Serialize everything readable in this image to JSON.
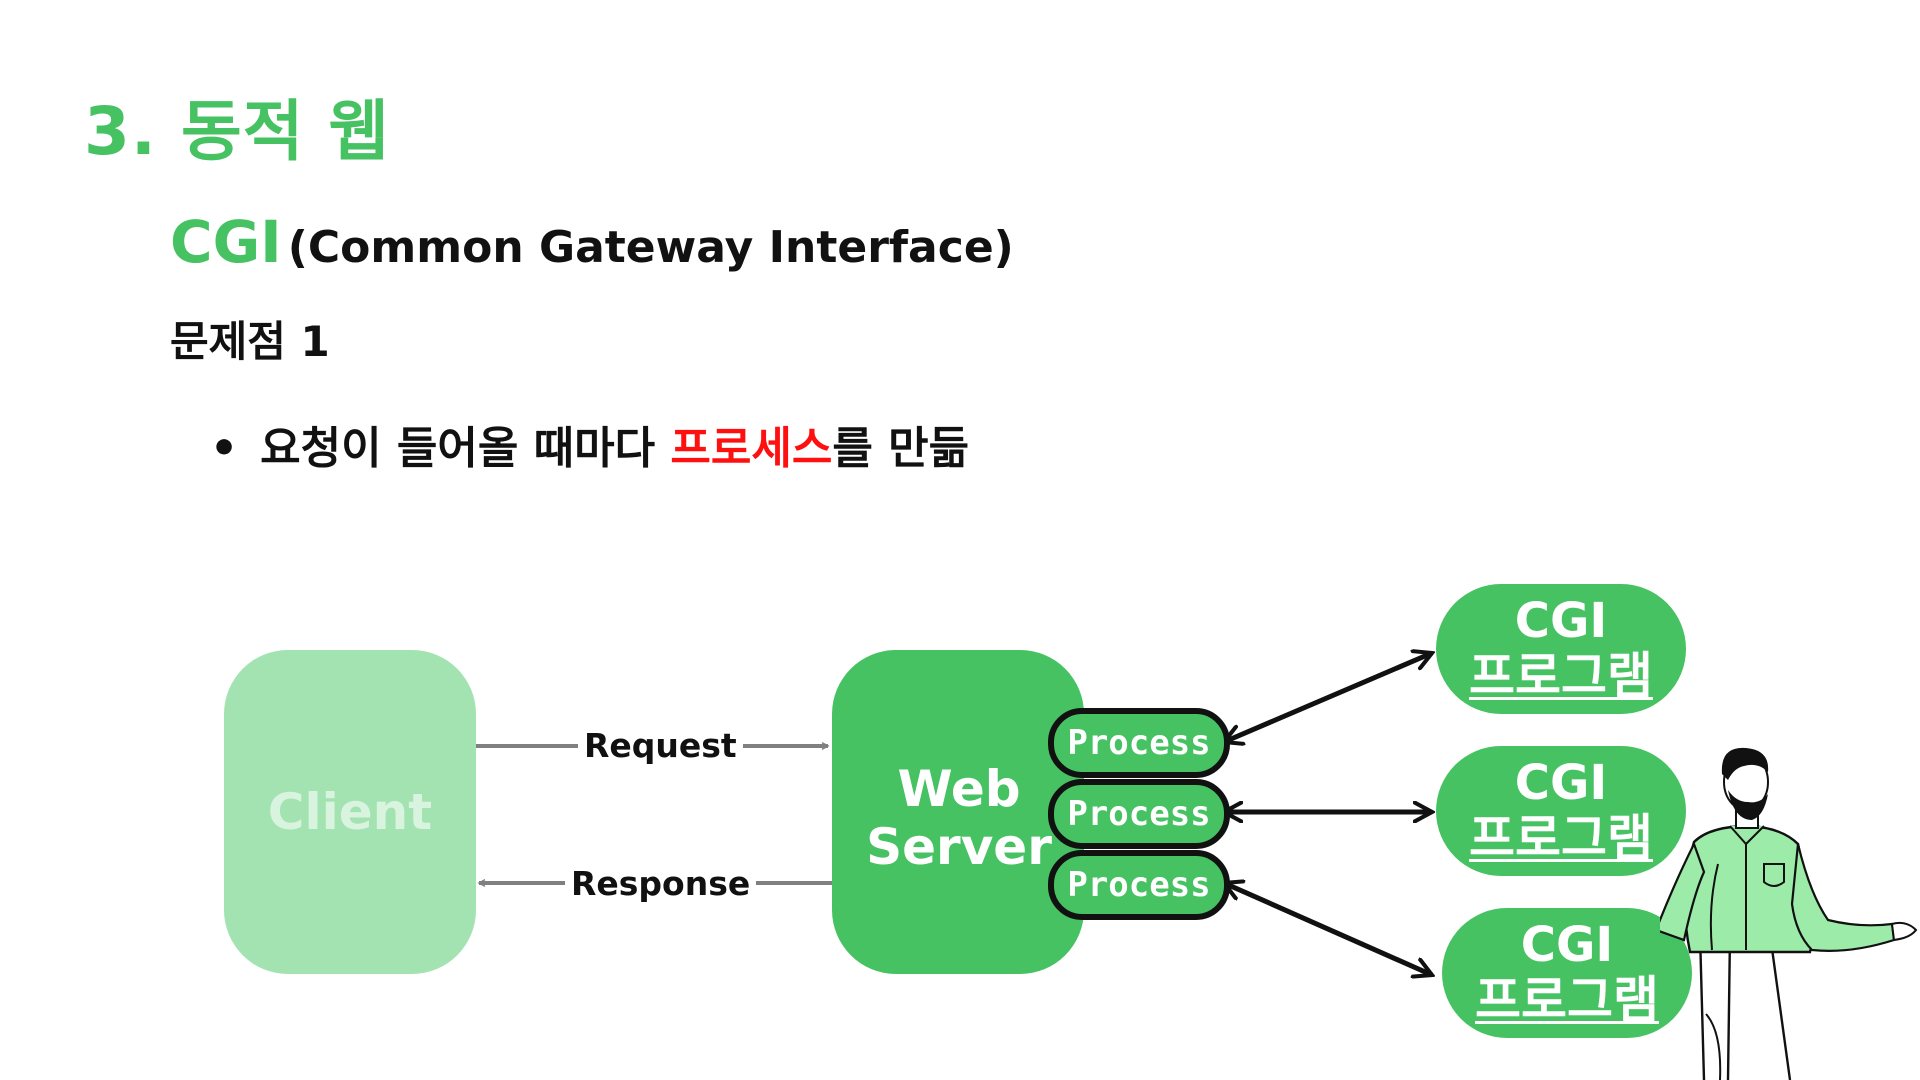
{
  "slide": {
    "title": "3. 동적 웹",
    "subtitle_main": "CGI",
    "subtitle_paren": "(Common Gateway Interface)",
    "problem": "문제점 1",
    "bullet_dot": "•",
    "bullet_before": "요청이 들어올 때마다 ",
    "bullet_highlight": "프로세스",
    "bullet_after": "를 만듦"
  },
  "diagram": {
    "client": "Client",
    "server_line1": "Web",
    "server_line2": "Server",
    "request": "Request",
    "response": "Response",
    "processes": [
      "Process",
      "Process",
      "Process"
    ],
    "cgi_programs": [
      {
        "line1": "CGI",
        "line2": "프로그램"
      },
      {
        "line1": "CGI",
        "line2": "프로그램"
      },
      {
        "line1": "CGI",
        "line2": "프로그램"
      }
    ]
  },
  "colors": {
    "accent_green": "#46c263",
    "client_green": "#a3e2b1",
    "highlight_red": "#ff1010",
    "person_shirt": "#9ceba9"
  }
}
